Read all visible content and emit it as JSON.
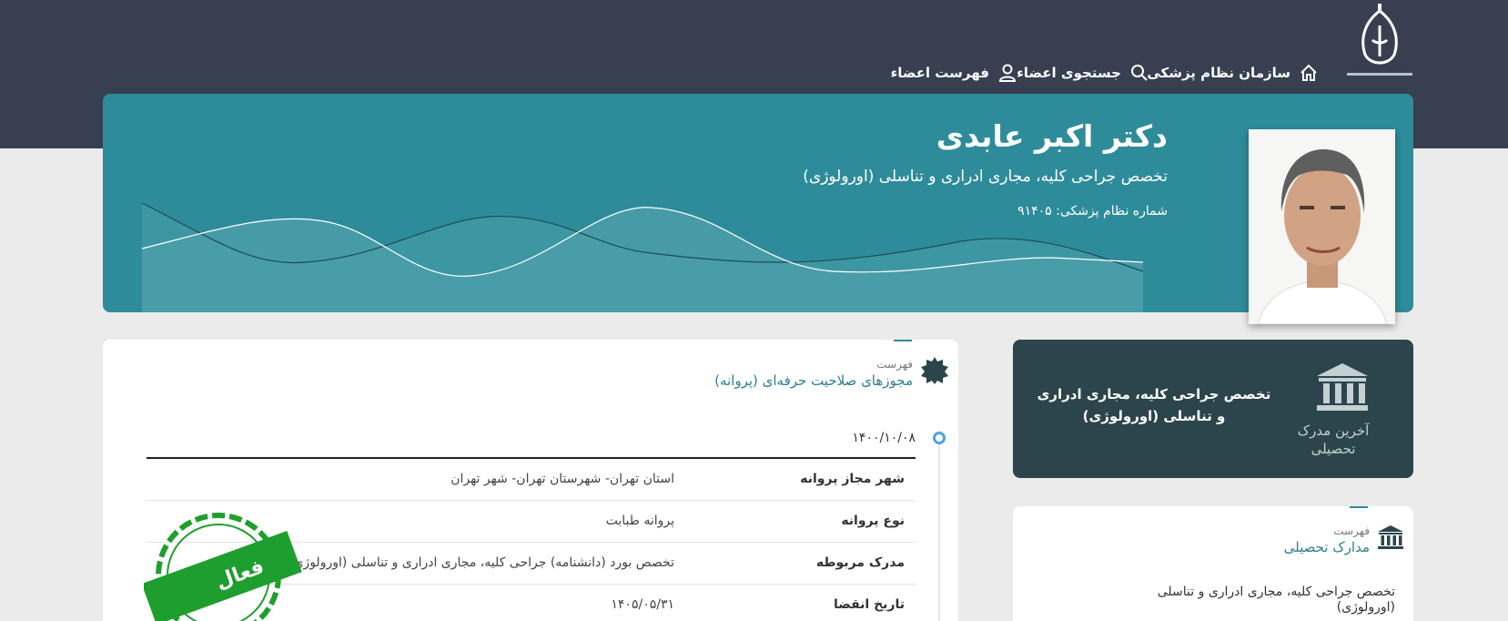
{
  "nav": {
    "home": "سازمان نظام پزشکی",
    "search": "جستجوی اعضاء",
    "list": "فهرست اعضاء"
  },
  "doctor": {
    "name": "دکتر اکبر عابدی",
    "specialty": "تخصص جراحی کلیه، مجاری ادراری و تناسلی (اورولوژی)",
    "number": "شماره نظام پزشکی: ۹۱۴۰۵"
  },
  "licenses": {
    "small": "فهرست",
    "title": "مجوزهای صلاحیت حرفه‌ای (پروانه)",
    "date": "۱۴۰۰/۱۰/۰۸",
    "rows": [
      {
        "label": "شهر مجاز پروانه",
        "value": "استان تهران- شهرستان تهران- شهر تهران"
      },
      {
        "label": "نوع پروانه",
        "value": "پروانه طبابت"
      },
      {
        "label": "مدرک مربوطه",
        "value": "تخصص بورد (دانشنامه) جراحی کلیه، مجاری ادراری و تناسلی (اورولوژی)"
      },
      {
        "label": "تاریخ انقضا",
        "value": "۱۴۰۵/۰۵/۳۱"
      }
    ],
    "stamp_text": "فعال"
  },
  "latest_degree": {
    "caption": "آخرین مدرک تحصیلی",
    "text": "تخصص جراحی کلیه، مجاری ادراری و تناسلی (اورولوژی)"
  },
  "degrees": {
    "small": "فهرست",
    "title": "مدارک تحصیلی",
    "item": "تخصص جراحی کلیه، مجاری ادراری و تناسلی (اورولوژی)"
  },
  "colors": {
    "header": "#373f51",
    "hero": "#2e8c9a",
    "edu_card": "#2c454c",
    "accent": "#2e7f8e",
    "stamp": "#1e9e2e"
  },
  "icons": [
    "logo-emblem",
    "home-icon",
    "search-icon",
    "user-icon",
    "badge-icon",
    "bank-icon",
    "timeline-dot"
  ]
}
